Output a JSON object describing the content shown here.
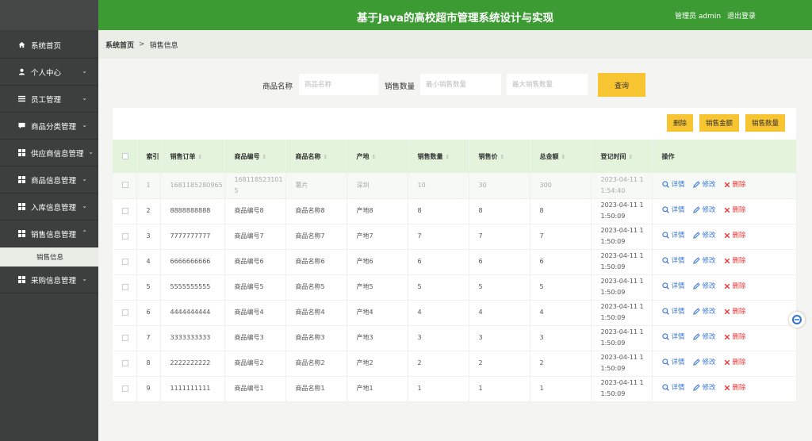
{
  "header": {
    "title": "基于Java的高校超市管理系统设计与实现",
    "user": "管理员 admin",
    "logout": "退出登录"
  },
  "sidebar": {
    "items": [
      {
        "label": "系统首页",
        "icon": "home-icon"
      },
      {
        "label": "个人中心",
        "icon": "user-icon"
      },
      {
        "label": "员工管理",
        "icon": "list-icon"
      },
      {
        "label": "商品分类管理",
        "icon": "chat-icon"
      },
      {
        "label": "供应商信息管理",
        "icon": "grid-icon"
      },
      {
        "label": "商品信息管理",
        "icon": "grid-icon"
      },
      {
        "label": "入库信息管理",
        "icon": "grid-icon"
      },
      {
        "label": "销售信息管理",
        "icon": "grid-icon"
      },
      {
        "label": "销售信息",
        "icon": ""
      },
      {
        "label": "采购信息管理",
        "icon": "grid-icon"
      }
    ]
  },
  "breadcrumb": {
    "home": "系统首页",
    "sep": ">",
    "current": "销售信息"
  },
  "search": {
    "name_label": "商品名称",
    "name_placeholder": "商品名称",
    "qty_label": "销售数量",
    "min_placeholder": "最小销售数量",
    "max_placeholder": "最大销售数量",
    "query": "查询"
  },
  "toolbar": {
    "delete": "删除",
    "sales_amount": "销售金额",
    "sales_qty": "销售数量"
  },
  "table": {
    "headers": [
      "索引",
      "销售订单",
      "商品编号",
      "商品名称",
      "产地",
      "销售数量",
      "销售价",
      "总金额",
      "登记时间",
      "操作"
    ],
    "ops": {
      "detail": "详情",
      "edit": "修改",
      "delete": "删除"
    },
    "rows": [
      {
        "idx": "1",
        "order": "1681185280965",
        "code": "1681185231015",
        "name": "薯片",
        "origin": "深圳",
        "qty": "10",
        "price": "30",
        "total": "300",
        "time": "2023-04-11 11:54:40"
      },
      {
        "idx": "2",
        "order": "8888888888",
        "code": "商品编号8",
        "name": "商品名称8",
        "origin": "产地8",
        "qty": "8",
        "price": "8",
        "total": "8",
        "time": "2023-04-11 11:50:09"
      },
      {
        "idx": "3",
        "order": "7777777777",
        "code": "商品编号7",
        "name": "商品名称7",
        "origin": "产地7",
        "qty": "7",
        "price": "7",
        "total": "7",
        "time": "2023-04-11 11:50:09"
      },
      {
        "idx": "4",
        "order": "6666666666",
        "code": "商品编号6",
        "name": "商品名称6",
        "origin": "产地6",
        "qty": "6",
        "price": "6",
        "total": "6",
        "time": "2023-04-11 11:50:09"
      },
      {
        "idx": "5",
        "order": "5555555555",
        "code": "商品编号5",
        "name": "商品名称5",
        "origin": "产地5",
        "qty": "5",
        "price": "5",
        "total": "5",
        "time": "2023-04-11 11:50:09"
      },
      {
        "idx": "6",
        "order": "4444444444",
        "code": "商品编号4",
        "name": "商品名称4",
        "origin": "产地4",
        "qty": "4",
        "price": "4",
        "total": "4",
        "time": "2023-04-11 11:50:09"
      },
      {
        "idx": "7",
        "order": "3333333333",
        "code": "商品编号3",
        "name": "商品名称3",
        "origin": "产地3",
        "qty": "3",
        "price": "3",
        "total": "3",
        "time": "2023-04-11 11:50:09"
      },
      {
        "idx": "8",
        "order": "2222222222",
        "code": "商品编号2",
        "name": "商品名称2",
        "origin": "产地2",
        "qty": "2",
        "price": "2",
        "total": "2",
        "time": "2023-04-11 11:50:09"
      },
      {
        "idx": "9",
        "order": "1111111111",
        "code": "商品编号1",
        "name": "商品名称1",
        "origin": "产地1",
        "qty": "1",
        "price": "1",
        "total": "1",
        "time": "2023-04-11 11:50:09"
      }
    ]
  },
  "colors": {
    "header": "#3d9b34",
    "sidebar": "#3c3f3e",
    "accent": "#f7c531",
    "link": "#3a7bd5",
    "danger": "#e53935"
  }
}
